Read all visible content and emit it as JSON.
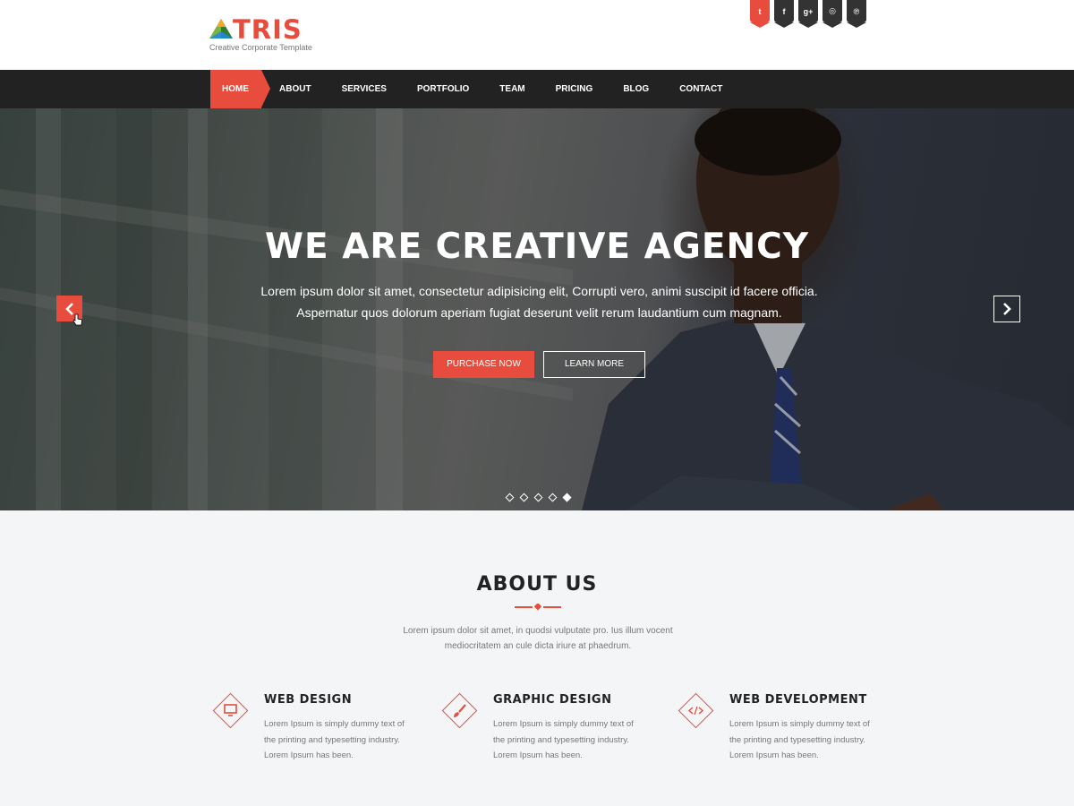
{
  "header": {
    "logo_text": "TRIS",
    "logo_tagline": "Creative Corporate Template",
    "social": [
      {
        "icon": "twitter-icon",
        "glyph": "t"
      },
      {
        "icon": "facebook-icon",
        "glyph": "f"
      },
      {
        "icon": "google-plus-icon",
        "glyph": "g+"
      },
      {
        "icon": "dribbble-icon",
        "glyph": "◎"
      },
      {
        "icon": "pinterest-icon",
        "glyph": "℗"
      }
    ]
  },
  "nav": {
    "items": [
      "HOME",
      "ABOUT",
      "SERVICES",
      "PORTFOLIO",
      "TEAM",
      "PRICING",
      "BLOG",
      "CONTACT"
    ],
    "active_index": 0
  },
  "hero": {
    "title": "WE ARE CREATIVE AGENCY",
    "text": "Lorem ipsum dolor sit amet, consectetur adipisicing elit, Corrupti vero, animi suscipit id facere officia. Aspernatur quos dolorum aperiam fugiat deserunt velit rerum laudantium cum magnam.",
    "primary_button": "PURCHASE NOW",
    "secondary_button": "LEARN MORE",
    "slide_count": 5,
    "active_slide": 5
  },
  "about": {
    "title": "ABOUT US",
    "text": "Lorem ipsum dolor sit amet, in quodsi vulputate pro. Ius illum vocent mediocritatem an cule dicta iriure at phaedrum.",
    "services": [
      {
        "title": "WEB DESIGN",
        "icon": "monitor-icon",
        "text": "Lorem Ipsum is simply dummy text of the printing and typesetting industry. Lorem Ipsum has been."
      },
      {
        "title": "GRAPHIC DESIGN",
        "icon": "paint-brush-icon",
        "text": "Lorem Ipsum is simply dummy text of the printing and typesetting industry. Lorem Ipsum has been."
      },
      {
        "title": "WEB DEVELOPMENT",
        "icon": "code-icon",
        "text": "Lorem Ipsum is simply dummy text of the printing and typesetting industry. Lorem Ipsum has been."
      }
    ]
  },
  "colors": {
    "accent": "#e74c3c",
    "nav_bg": "#222222",
    "section_bg": "#f4f5f7"
  }
}
